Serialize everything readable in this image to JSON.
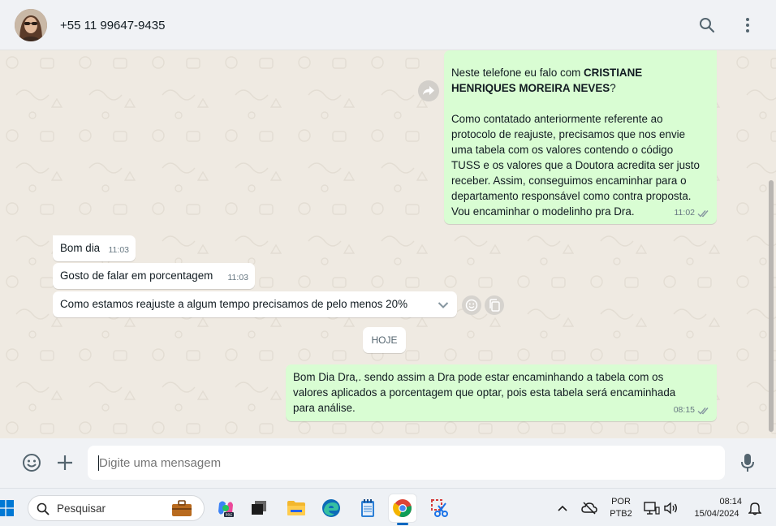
{
  "header": {
    "contact_name": "+55 11 99647-9435",
    "icons": [
      "search-icon",
      "menu-dots-icon"
    ]
  },
  "messages": {
    "m1": {
      "line1_pre": "Neste telefone eu falo com ",
      "line1_bold": "CRISTIANE",
      "line2_bold": "HENRIQUES MOREIRA NEVES",
      "line2_post": "?",
      "body": "Como contatado anteriormente referente ao\nprotocolo de reajuste, precisamos que nos envie\numa tabela com os valores contendo o código\nTUSS e os valores que a Doutora acredita ser justo\nreceber. Assim, conseguimos encaminhar para o\ndepartamento responsável como contra proposta.\nVou encaminhar o modelinho pra Dra.",
      "time": "11:02"
    },
    "m2": {
      "text": "Bom dia",
      "time": "11:03"
    },
    "m3": {
      "text": "Gosto de falar em porcentagem",
      "time": "11:03"
    },
    "m4": {
      "text": "Como estamos reajuste a algum tempo precisamos de pelo menos 20%"
    },
    "date_chip": "HOJE",
    "m5": {
      "text": "Bom Dia Dra,. sendo assim a Dra pode estar encaminhando a tabela com os\nvalores aplicados a porcentagem que optar, pois esta tabela será encaminhada\npara análise.",
      "time": "08:15"
    }
  },
  "compose": {
    "placeholder": "Digite uma mensagem"
  },
  "taskbar": {
    "search_label": "Pesquisar",
    "lang_top": "POR",
    "lang_bottom": "PTB2",
    "time": "08:14",
    "date": "15/04/2024",
    "colors": {
      "accent": "#0067c0"
    }
  },
  "colors": {
    "outgoing_bubble": "#d9fdd3",
    "incoming_bubble": "#ffffff",
    "chat_bg": "#efeae2",
    "read_ticks": "#8696a0"
  }
}
